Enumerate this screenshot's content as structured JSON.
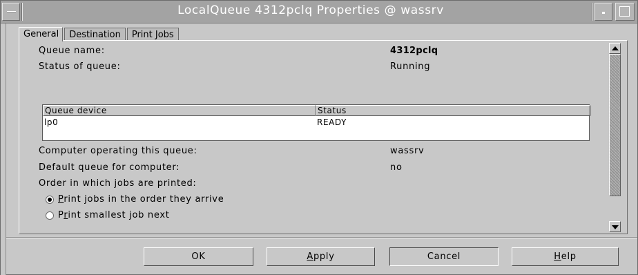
{
  "window": {
    "title": "LocalQueue 4312pclq Properties @ wassrv"
  },
  "tabs": [
    {
      "label": "General",
      "active": true
    },
    {
      "label": "Destination",
      "active": false
    },
    {
      "label": "Print Jobs",
      "active": false
    }
  ],
  "general": {
    "queue_name_label": "Queue name:",
    "queue_name_value": "4312pclq",
    "status_label": "Status of queue:",
    "status_value": "Running",
    "device_table": {
      "columns": [
        "Queue device",
        "Status"
      ],
      "rows": [
        [
          "lp0",
          "READY"
        ]
      ]
    },
    "computer_label": "Computer operating this queue:",
    "computer_value": "wassrv",
    "default_label": "Default queue for computer:",
    "default_value": "no",
    "order_label": "Order in which jobs are printed:",
    "order_options": [
      {
        "label": "Print jobs in the order they arrive",
        "selected": true,
        "mnemonic": "P"
      },
      {
        "label": "Print smallest job next",
        "selected": false,
        "mnemonic": "r"
      }
    ]
  },
  "buttons": {
    "ok": "OK",
    "apply": "Apply",
    "cancel": "Cancel",
    "help": "Help"
  }
}
